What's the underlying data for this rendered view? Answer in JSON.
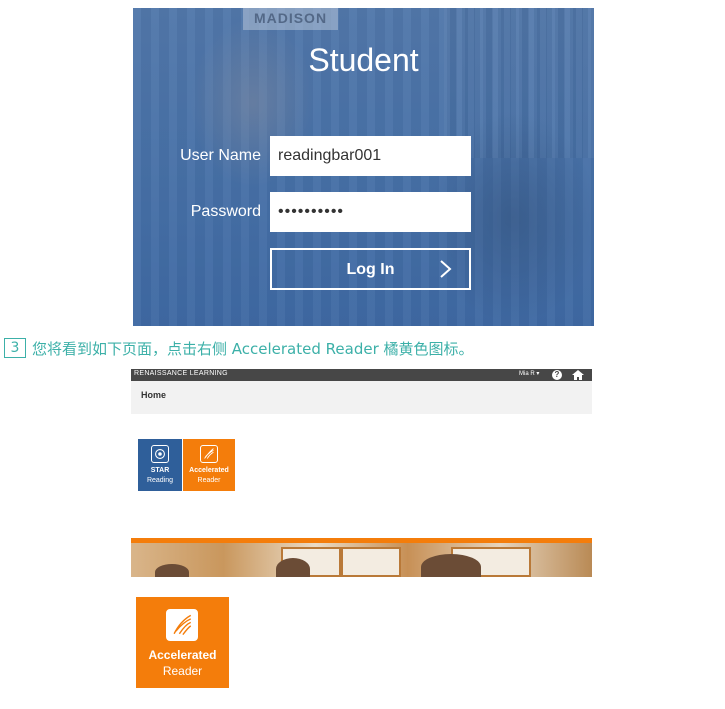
{
  "login": {
    "title": "Student",
    "username_label": "User Name",
    "username_value": "readingbar001",
    "password_label": "Password",
    "password_value": "••••••••••",
    "login_button": "Log In",
    "background_sign": "MADISON"
  },
  "instruction": {
    "step": "3",
    "text": "您将看到如下页面，点击右侧 Accelerated Reader 橘黄色图标。"
  },
  "renaissance_home": {
    "brand": "RENAISSANCE LEARNING",
    "user_menu": "Mia R ▾",
    "help_icon": "?",
    "home_title": "Home",
    "apps": [
      {
        "line1": "STAR",
        "line2": "Reading",
        "color": "#2f5f9a",
        "icon": "star-reading-icon"
      },
      {
        "line1": "Accelerated",
        "line2": "Reader",
        "color": "#f47d0b",
        "icon": "accelerated-reader-icon"
      }
    ]
  },
  "accelerated_reader_large": {
    "line1": "Accelerated",
    "line2": "Reader",
    "color": "#f47d0b"
  },
  "colors": {
    "login_blue": "#4f77ab",
    "accent_teal": "#3cb0a8",
    "ar_orange": "#f47d0b",
    "star_blue": "#2f5f9a",
    "topbar_gray": "#474747"
  }
}
